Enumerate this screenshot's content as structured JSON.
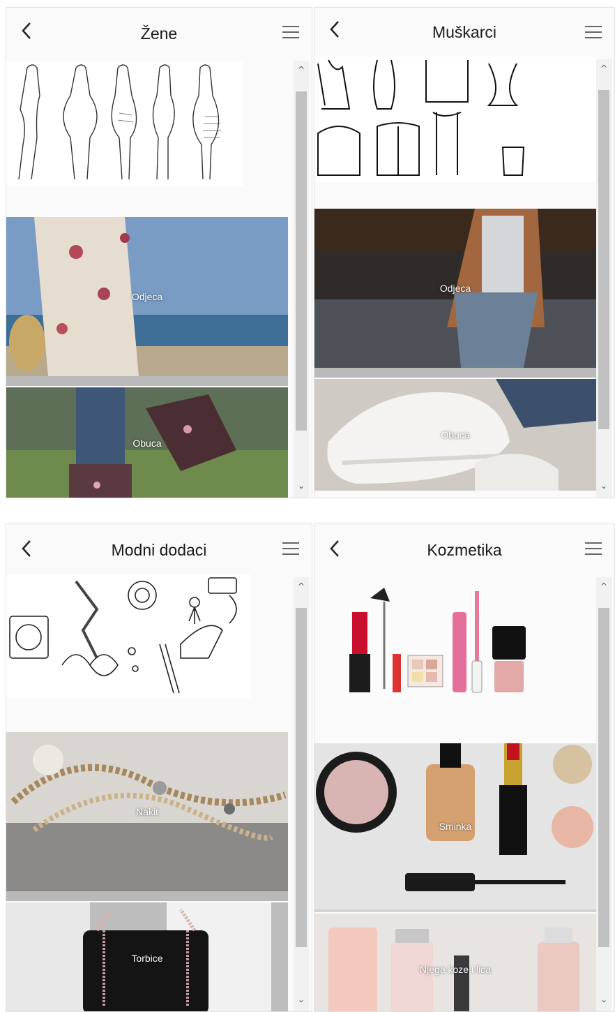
{
  "screens": [
    {
      "title": "Žene",
      "categories": [
        {
          "label": "Odjeca"
        },
        {
          "label": "Obuca"
        }
      ]
    },
    {
      "title": "Muškarci",
      "categories": [
        {
          "label": "Odjeca"
        },
        {
          "label": "Obuca"
        }
      ]
    },
    {
      "title": "Modni dodaci",
      "categories": [
        {
          "label": "Nakit"
        },
        {
          "label": "Torbice"
        }
      ]
    },
    {
      "title": "Kozmetika",
      "categories": [
        {
          "label": "Sminka"
        },
        {
          "label": "Njega koze i lica"
        }
      ]
    }
  ],
  "icons": {
    "back": "chevron-left-icon",
    "menu": "hamburger-menu-icon",
    "scroll_up": "caret-up-icon",
    "scroll_down": "caret-down-icon"
  },
  "glyphs": {
    "scroll_up": "^",
    "scroll_down": "⌄"
  }
}
